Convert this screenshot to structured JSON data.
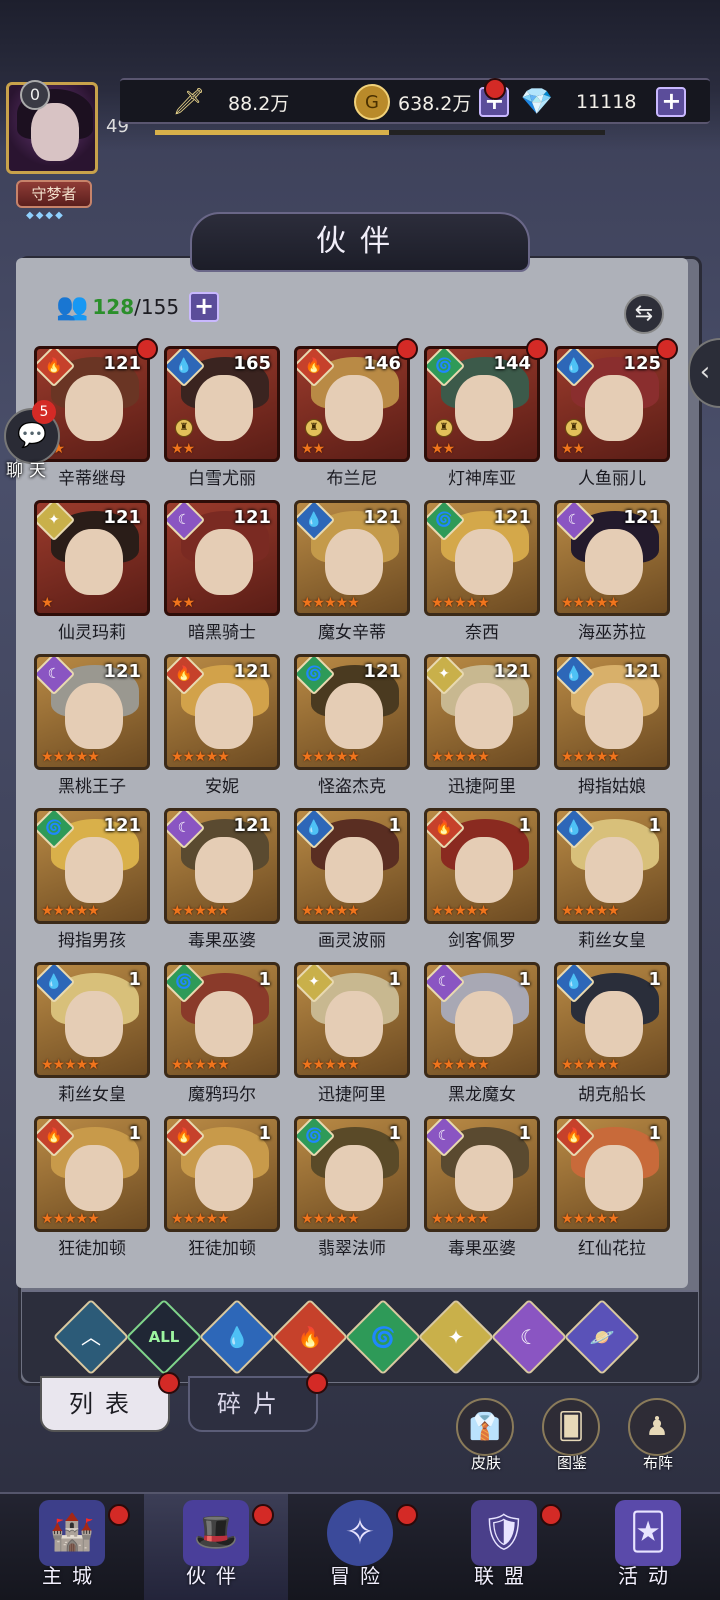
{
  "header": {
    "vip_level": "0",
    "player_level": "49",
    "title_badge": "守梦者",
    "power_value": "88.2万",
    "gold_value": "638.2万",
    "gem_value": "11118",
    "xp_progress": 0.52,
    "icons": {
      "power": "sword-icon",
      "gold": "gold-coin-icon",
      "gem": "diamond-icon",
      "plus": "plus-icon"
    }
  },
  "banner": {
    "title": "伙伴"
  },
  "roster": {
    "current": "128",
    "total": "/155"
  },
  "chat": {
    "label": "聊天",
    "unread": "5"
  },
  "cards": [
    {
      "name": "辛蒂继母",
      "level": "121",
      "element": "fire",
      "stars": 2,
      "red_dot": true,
      "frame": "red",
      "hair": "#6a3524"
    },
    {
      "name": "白雪尤丽",
      "level": "165",
      "element": "water",
      "stars": 2,
      "red_dot": false,
      "frame": "red",
      "hair": "#3a2420",
      "badge": true
    },
    {
      "name": "布兰尼",
      "level": "146",
      "element": "fire",
      "stars": 2,
      "red_dot": true,
      "frame": "red",
      "hair": "#b98a45",
      "badge": true
    },
    {
      "name": "灯神库亚",
      "level": "144",
      "element": "wind",
      "stars": 2,
      "red_dot": true,
      "frame": "red",
      "hair": "#3c5a4a",
      "badge": true
    },
    {
      "name": "人鱼丽儿",
      "level": "125",
      "element": "water",
      "stars": 2,
      "red_dot": true,
      "frame": "red",
      "hair": "#8a2e2e",
      "badge": true
    },
    {
      "name": "仙灵玛莉",
      "level": "121",
      "element": "light",
      "stars": 1,
      "red_dot": false,
      "frame": "red",
      "hair": "#2a1d18"
    },
    {
      "name": "暗黑骑士",
      "level": "121",
      "element": "dark",
      "stars": 2,
      "red_dot": false,
      "frame": "red",
      "hair": "#7a2a22"
    },
    {
      "name": "魔女辛蒂",
      "level": "121",
      "element": "water",
      "stars": 5,
      "red_dot": false,
      "frame": "gold",
      "hair": "#c49a4a"
    },
    {
      "name": "奈西",
      "level": "121",
      "element": "wind",
      "stars": 5,
      "red_dot": false,
      "frame": "gold",
      "hair": "#d4a84a"
    },
    {
      "name": "海巫苏拉",
      "level": "121",
      "element": "dark",
      "stars": 5,
      "red_dot": false,
      "frame": "gold",
      "hair": "#231a2c"
    },
    {
      "name": "黑桃王子",
      "level": "121",
      "element": "dark",
      "stars": 5,
      "red_dot": false,
      "frame": "gold",
      "hair": "#9a9890"
    },
    {
      "name": "安妮",
      "level": "121",
      "element": "fire",
      "stars": 5,
      "red_dot": false,
      "frame": "gold",
      "hair": "#d2a24a"
    },
    {
      "name": "怪盗杰克",
      "level": "121",
      "element": "wind",
      "stars": 5,
      "red_dot": false,
      "frame": "gold",
      "hair": "#4a3a20"
    },
    {
      "name": "迅捷阿里",
      "level": "121",
      "element": "light",
      "stars": 5,
      "red_dot": false,
      "frame": "gold",
      "hair": "#c8b890"
    },
    {
      "name": "拇指姑娘",
      "level": "121",
      "element": "water",
      "stars": 5,
      "red_dot": false,
      "frame": "gold",
      "hair": "#d8b06a"
    },
    {
      "name": "拇指男孩",
      "level": "121",
      "element": "wind",
      "stars": 5,
      "red_dot": false,
      "frame": "gold",
      "hair": "#d9b04a"
    },
    {
      "name": "毒果巫婆",
      "level": "121",
      "element": "dark",
      "stars": 5,
      "red_dot": false,
      "frame": "gold",
      "hair": "#5a4a30"
    },
    {
      "name": "画灵波丽",
      "level": "1",
      "element": "water",
      "stars": 5,
      "red_dot": false,
      "frame": "gold",
      "hair": "#5a2e22"
    },
    {
      "name": "剑客佩罗",
      "level": "1",
      "element": "fire",
      "stars": 5,
      "red_dot": false,
      "frame": "gold",
      "hair": "#8a2a20"
    },
    {
      "name": "莉丝女皇",
      "level": "1",
      "element": "water",
      "stars": 5,
      "red_dot": false,
      "frame": "gold",
      "hair": "#d8c07a"
    },
    {
      "name": "莉丝女皇",
      "level": "1",
      "element": "water",
      "stars": 5,
      "red_dot": false,
      "frame": "gold",
      "hair": "#d8c07a"
    },
    {
      "name": "魔鸦玛尔",
      "level": "1",
      "element": "wind",
      "stars": 5,
      "red_dot": false,
      "frame": "gold",
      "hair": "#8a3a2a"
    },
    {
      "name": "迅捷阿里",
      "level": "1",
      "element": "light",
      "stars": 5,
      "red_dot": false,
      "frame": "gold",
      "hair": "#c8b890"
    },
    {
      "name": "黑龙魔女",
      "level": "1",
      "element": "dark",
      "stars": 5,
      "red_dot": false,
      "frame": "gold",
      "hair": "#a8a8b4"
    },
    {
      "name": "胡克船长",
      "level": "1",
      "element": "water",
      "stars": 5,
      "red_dot": false,
      "frame": "gold",
      "hair": "#2a2e3a"
    },
    {
      "name": "狂徒加顿",
      "level": "1",
      "element": "fire",
      "stars": 5,
      "red_dot": false,
      "frame": "gold",
      "hair": "#c89a4a"
    },
    {
      "name": "狂徒加顿",
      "level": "1",
      "element": "fire",
      "stars": 5,
      "red_dot": false,
      "frame": "gold",
      "hair": "#c89a4a"
    },
    {
      "name": "翡翠法师",
      "level": "1",
      "element": "wind",
      "stars": 5,
      "red_dot": false,
      "frame": "gold",
      "hair": "#5a4a28"
    },
    {
      "name": "毒果巫婆",
      "level": "1",
      "element": "dark",
      "stars": 5,
      "red_dot": false,
      "frame": "gold",
      "hair": "#5a4a30"
    },
    {
      "name": "红仙花拉",
      "level": "1",
      "element": "fire",
      "stars": 5,
      "red_dot": false,
      "frame": "gold",
      "hair": "#c86a3a"
    }
  ],
  "element_glyphs": {
    "fire": "🔥",
    "water": "💧",
    "wind": "🌀",
    "light": "✦",
    "dark": "☾"
  },
  "filters": [
    {
      "id": "base",
      "glyph": "︿"
    },
    {
      "id": "all",
      "glyph": "ALL"
    },
    {
      "id": "water",
      "glyph": "💧"
    },
    {
      "id": "fire",
      "glyph": "🔥"
    },
    {
      "id": "wind",
      "glyph": "🌀"
    },
    {
      "id": "light",
      "glyph": "✦"
    },
    {
      "id": "dark",
      "glyph": "☾"
    },
    {
      "id": "cosmos",
      "glyph": "🪐"
    }
  ],
  "tabs": {
    "list": "列表",
    "shards": "碎片"
  },
  "side_buttons": {
    "skin": "皮肤",
    "codex": "图鉴",
    "formation": "布阵"
  },
  "nav": {
    "castle": "主城",
    "partners": "伙伴",
    "adventure": "冒险",
    "alliance": "联盟",
    "events": "活动"
  },
  "colors": {
    "accent_gold": "#d7b04a",
    "roster_green": "#2b8f2b",
    "notice_red": "#d42a26"
  }
}
